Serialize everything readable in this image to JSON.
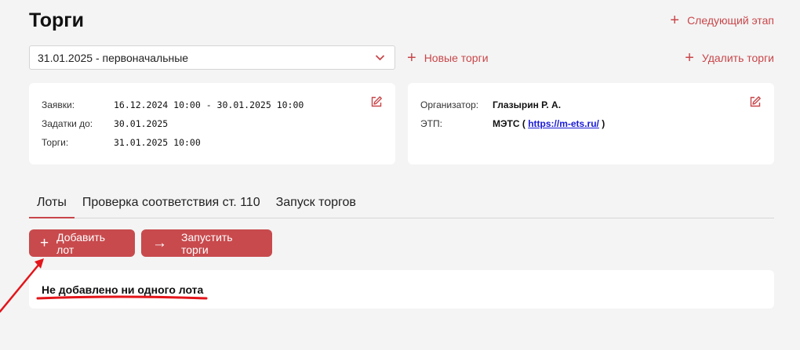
{
  "header": {
    "title": "Торги",
    "next_stage": "Следующий этап",
    "new_auction": "Новые торги",
    "delete_auction": "Удалить торги"
  },
  "select": {
    "value": "31.01.2025 - первоначальные"
  },
  "dates_card": {
    "rows": [
      {
        "label": "Заявки:",
        "value": "16.12.2024 10:00 - 30.01.2025 10:00"
      },
      {
        "label": "Задатки до:",
        "value": "30.01.2025"
      },
      {
        "label": "Торги:",
        "value": "31.01.2025 10:00"
      }
    ]
  },
  "organizer_card": {
    "organizer_label": "Организатор:",
    "organizer_value": "Глазырин Р. А.",
    "etp_label": "ЭТП:",
    "etp_name": "МЭТС (",
    "etp_link": "https://m-ets.ru/",
    "etp_close": ")"
  },
  "tabs": [
    {
      "label": "Лоты",
      "active": true
    },
    {
      "label": "Проверка соответствия ст. 110",
      "active": false
    },
    {
      "label": "Запуск торгов",
      "active": false
    }
  ],
  "buttons": {
    "add_lot": "Добавить лот",
    "run_auction": "Запустить торги"
  },
  "empty_state": "Не добавлено ни одного лота",
  "colors": {
    "accent": "#c8464a",
    "annotation": "#e3151a"
  }
}
